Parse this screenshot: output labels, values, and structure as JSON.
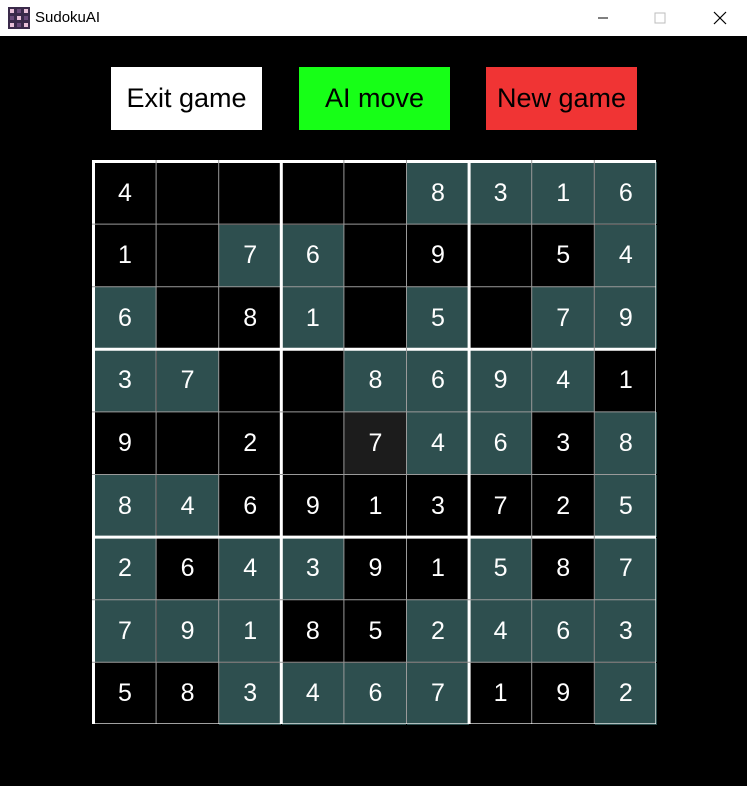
{
  "window": {
    "title": "SudokuAI",
    "minimize_glyph": "—",
    "maximize_glyph": "☐",
    "close_glyph": "✕"
  },
  "toolbar": {
    "exit_label": "Exit game",
    "ai_label": "AI move",
    "new_label": "New game"
  },
  "colors": {
    "given_cell": "#2e4f4f",
    "empty_cell": "#000000",
    "selected_cell": "#1c1c1c",
    "exit_button": "#ffffff",
    "ai_button": "#17ff17",
    "new_button": "#f03434"
  },
  "board": {
    "selected": [
      4,
      4
    ],
    "rows": [
      [
        {
          "v": "4",
          "t": "p"
        },
        {
          "v": "",
          "t": "p"
        },
        {
          "v": "",
          "t": "p"
        },
        {
          "v": "",
          "t": "p"
        },
        {
          "v": "",
          "t": "p"
        },
        {
          "v": "8",
          "t": "g"
        },
        {
          "v": "3",
          "t": "g"
        },
        {
          "v": "1",
          "t": "g"
        },
        {
          "v": "6",
          "t": "g"
        }
      ],
      [
        {
          "v": "1",
          "t": "p"
        },
        {
          "v": "",
          "t": "p"
        },
        {
          "v": "7",
          "t": "g"
        },
        {
          "v": "6",
          "t": "g"
        },
        {
          "v": "",
          "t": "p"
        },
        {
          "v": "9",
          "t": "p"
        },
        {
          "v": "",
          "t": "p"
        },
        {
          "v": "5",
          "t": "p"
        },
        {
          "v": "4",
          "t": "g"
        }
      ],
      [
        {
          "v": "6",
          "t": "g"
        },
        {
          "v": "",
          "t": "p"
        },
        {
          "v": "8",
          "t": "p"
        },
        {
          "v": "1",
          "t": "g"
        },
        {
          "v": "",
          "t": "p"
        },
        {
          "v": "5",
          "t": "g"
        },
        {
          "v": "",
          "t": "p"
        },
        {
          "v": "7",
          "t": "g"
        },
        {
          "v": "9",
          "t": "g"
        }
      ],
      [
        {
          "v": "3",
          "t": "g"
        },
        {
          "v": "7",
          "t": "g"
        },
        {
          "v": "",
          "t": "p"
        },
        {
          "v": "",
          "t": "p"
        },
        {
          "v": "8",
          "t": "g"
        },
        {
          "v": "6",
          "t": "g"
        },
        {
          "v": "9",
          "t": "g"
        },
        {
          "v": "4",
          "t": "g"
        },
        {
          "v": "1",
          "t": "p"
        }
      ],
      [
        {
          "v": "9",
          "t": "p"
        },
        {
          "v": "",
          "t": "p"
        },
        {
          "v": "2",
          "t": "p"
        },
        {
          "v": "",
          "t": "p"
        },
        {
          "v": "7",
          "t": "s"
        },
        {
          "v": "4",
          "t": "g"
        },
        {
          "v": "6",
          "t": "g"
        },
        {
          "v": "3",
          "t": "p"
        },
        {
          "v": "8",
          "t": "g"
        }
      ],
      [
        {
          "v": "8",
          "t": "g"
        },
        {
          "v": "4",
          "t": "g"
        },
        {
          "v": "6",
          "t": "p"
        },
        {
          "v": "9",
          "t": "p"
        },
        {
          "v": "1",
          "t": "p"
        },
        {
          "v": "3",
          "t": "p"
        },
        {
          "v": "7",
          "t": "p"
        },
        {
          "v": "2",
          "t": "p"
        },
        {
          "v": "5",
          "t": "g"
        }
      ],
      [
        {
          "v": "2",
          "t": "g"
        },
        {
          "v": "6",
          "t": "p"
        },
        {
          "v": "4",
          "t": "g"
        },
        {
          "v": "3",
          "t": "g"
        },
        {
          "v": "9",
          "t": "p"
        },
        {
          "v": "1",
          "t": "p"
        },
        {
          "v": "5",
          "t": "g"
        },
        {
          "v": "8",
          "t": "p"
        },
        {
          "v": "7",
          "t": "g"
        }
      ],
      [
        {
          "v": "7",
          "t": "g"
        },
        {
          "v": "9",
          "t": "g"
        },
        {
          "v": "1",
          "t": "g"
        },
        {
          "v": "8",
          "t": "p"
        },
        {
          "v": "5",
          "t": "p"
        },
        {
          "v": "2",
          "t": "g"
        },
        {
          "v": "4",
          "t": "g"
        },
        {
          "v": "6",
          "t": "g"
        },
        {
          "v": "3",
          "t": "g"
        }
      ],
      [
        {
          "v": "5",
          "t": "p"
        },
        {
          "v": "8",
          "t": "p"
        },
        {
          "v": "3",
          "t": "g"
        },
        {
          "v": "4",
          "t": "g"
        },
        {
          "v": "6",
          "t": "g"
        },
        {
          "v": "7",
          "t": "g"
        },
        {
          "v": "1",
          "t": "p"
        },
        {
          "v": "9",
          "t": "p"
        },
        {
          "v": "2",
          "t": "g"
        }
      ]
    ]
  }
}
